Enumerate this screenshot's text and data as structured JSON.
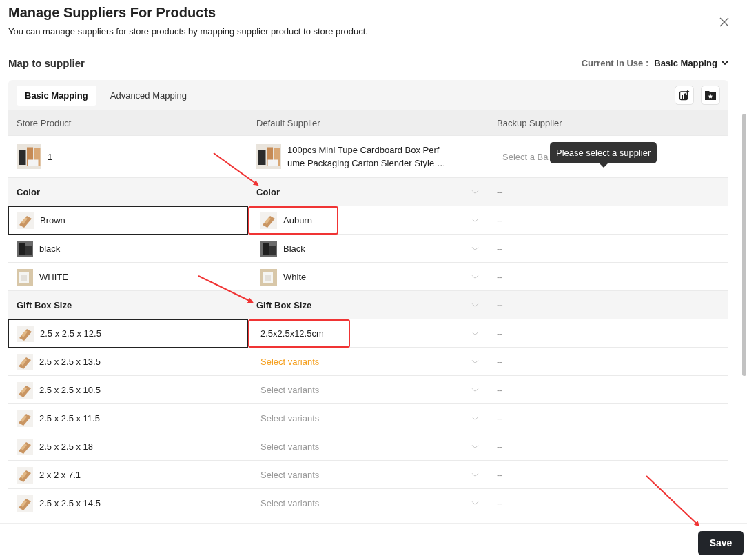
{
  "title": "Manage Suppliers For Products",
  "subtitle": "You can manage suppliers for store products by mapping supplier product to store product.",
  "section_label": "Map to supplier",
  "current_in_use": {
    "label": "Current In Use :",
    "value": "Basic Mapping"
  },
  "tabs": [
    {
      "label": "Basic Mapping",
      "selected": true
    },
    {
      "label": "Advanced Mapping",
      "selected": false
    }
  ],
  "columns": [
    "Store Product",
    "Default Supplier",
    "Backup Supplier"
  ],
  "product": {
    "store_name": "1",
    "supplier_name": "100pcs Mini Tupe Cardboard Box Perf\nume Packaging Carton Slender Style …",
    "backup_placeholder": "Select a Ba",
    "tooltip": "Please select a supplier"
  },
  "groups": [
    {
      "store_option": "Color",
      "supplier_option": "Color",
      "backup": "--",
      "rows": [
        {
          "store_value": "Brown",
          "supplier_value": "Auburn",
          "kind": "mapped",
          "outlined": true,
          "annotated": true,
          "backup": "--"
        },
        {
          "store_value": "black",
          "supplier_value": "Black",
          "kind": "mapped",
          "outlined": false,
          "annotated": false,
          "backup": "--"
        },
        {
          "store_value": "WHITE",
          "supplier_value": "White",
          "kind": "mapped",
          "outlined": false,
          "annotated": false,
          "backup": "--"
        }
      ]
    },
    {
      "store_option": "Gift Box Size",
      "supplier_option": "Gift Box Size",
      "backup": "--",
      "rows": [
        {
          "store_value": "2.5 x 2.5 x 12.5",
          "supplier_value": "2.5x2.5x12.5cm",
          "kind": "text",
          "outlined": true,
          "annotated": true,
          "backup": "--"
        },
        {
          "store_value": "2.5 x 2.5 x 13.5",
          "supplier_value": "Select variants",
          "kind": "placeholder",
          "outlined": false,
          "annotated": false,
          "warning": true,
          "backup": "--"
        },
        {
          "store_value": "2.5 x 2.5 x 10.5",
          "supplier_value": "Select variants",
          "kind": "placeholder",
          "outlined": false,
          "annotated": false,
          "warning": false,
          "backup": "--"
        },
        {
          "store_value": "2.5 x 2.5 x 11.5",
          "supplier_value": "Select variants",
          "kind": "placeholder",
          "outlined": false,
          "annotated": false,
          "warning": false,
          "backup": "--"
        },
        {
          "store_value": "2.5 x 2.5 x 18",
          "supplier_value": "Select variants",
          "kind": "placeholder",
          "outlined": false,
          "annotated": false,
          "warning": false,
          "backup": "--"
        },
        {
          "store_value": "2 x 2 x 7.1",
          "supplier_value": "Select variants",
          "kind": "placeholder",
          "outlined": false,
          "annotated": false,
          "warning": false,
          "backup": "--"
        },
        {
          "store_value": "2.5 x 2.5 x 14.5",
          "supplier_value": "Select variants",
          "kind": "placeholder",
          "outlined": false,
          "annotated": false,
          "warning": false,
          "backup": "--"
        }
      ]
    }
  ],
  "save_button": "Save"
}
